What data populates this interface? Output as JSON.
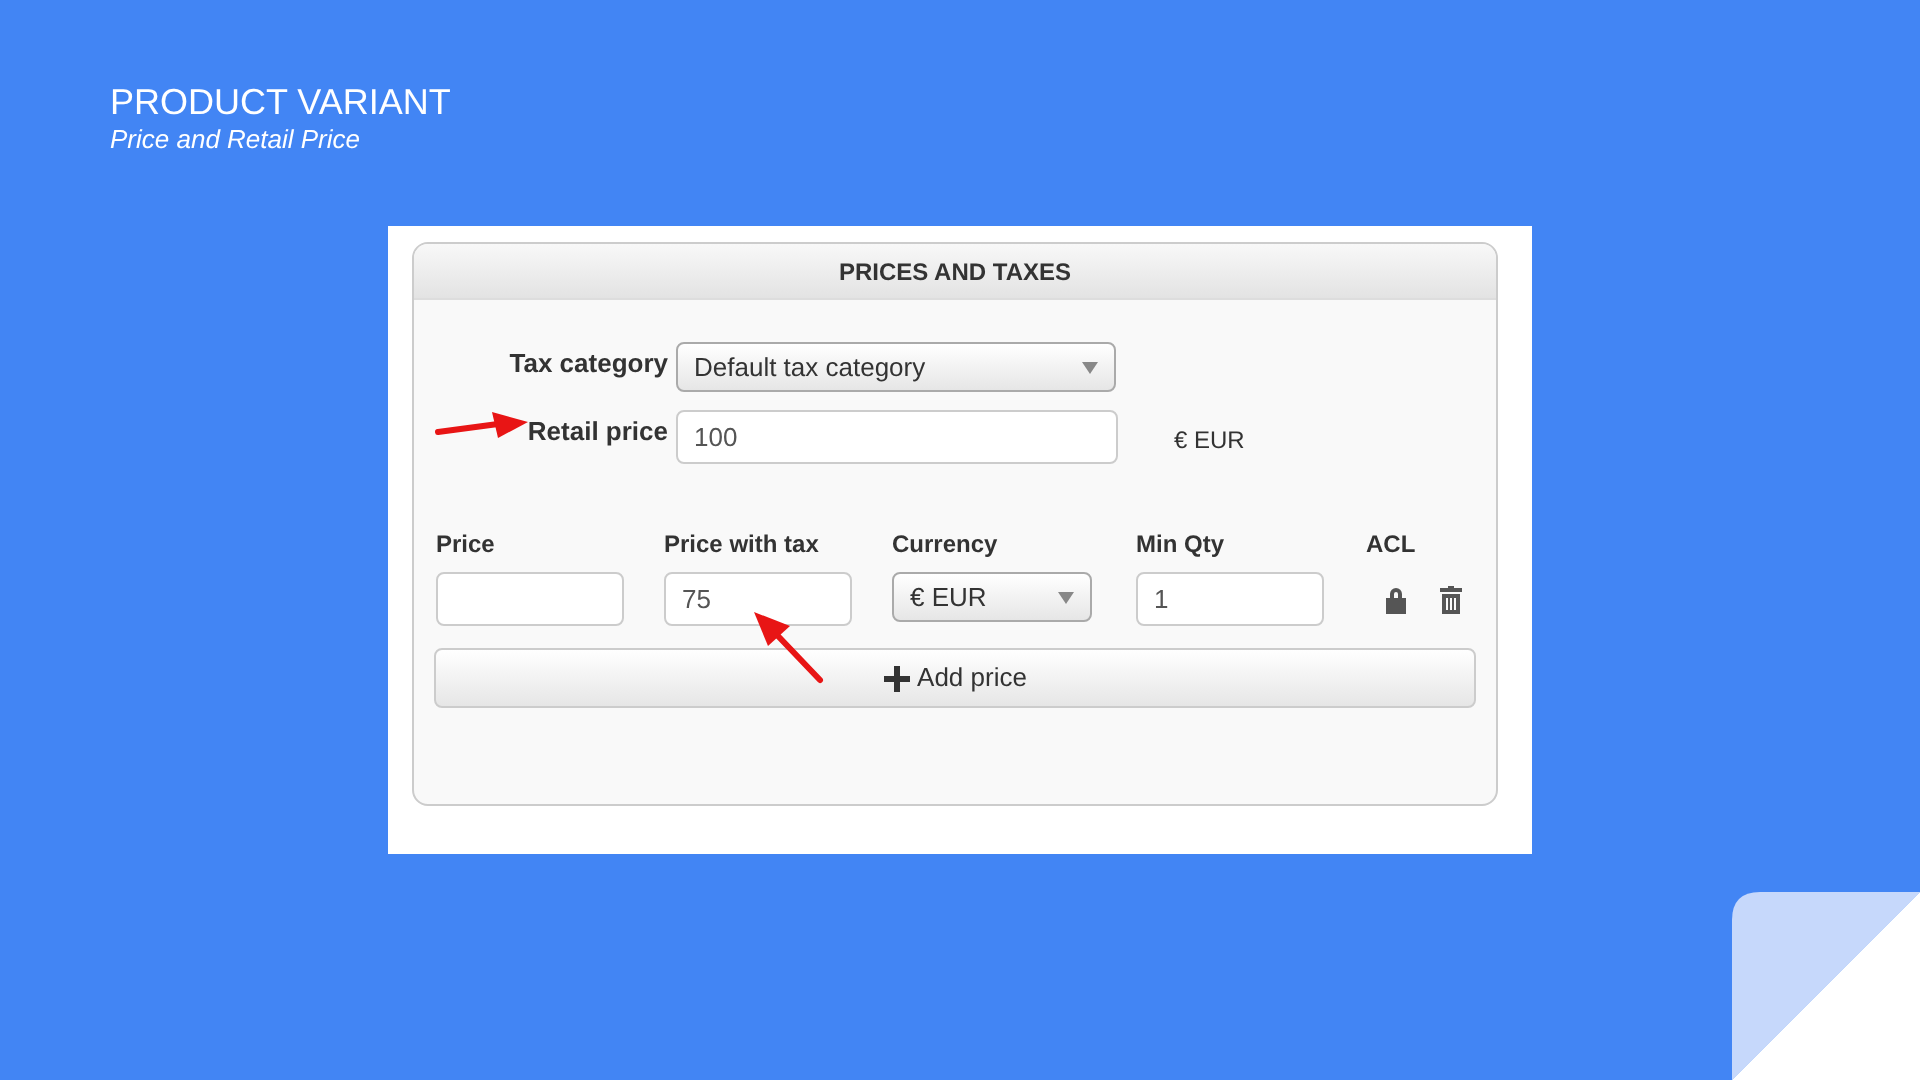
{
  "slide": {
    "title": "PRODUCT VARIANT",
    "subtitle": "Price and Retail Price"
  },
  "panel": {
    "title": "PRICES AND TAXES",
    "fields": [
      {
        "label": "Tax category",
        "kind": "select",
        "value": "Default tax category"
      },
      {
        "label": "Retail price",
        "kind": "input",
        "value": "100",
        "suffix": "€ EUR"
      }
    ],
    "price_table": {
      "columns": [
        "Price",
        "Price with tax",
        "Currency",
        "Min Qty",
        "ACL"
      ],
      "rows": [
        {
          "price_with_tax": "75",
          "currency": "€ EUR",
          "min_qty": "1"
        }
      ]
    },
    "add_button": "Add price"
  }
}
